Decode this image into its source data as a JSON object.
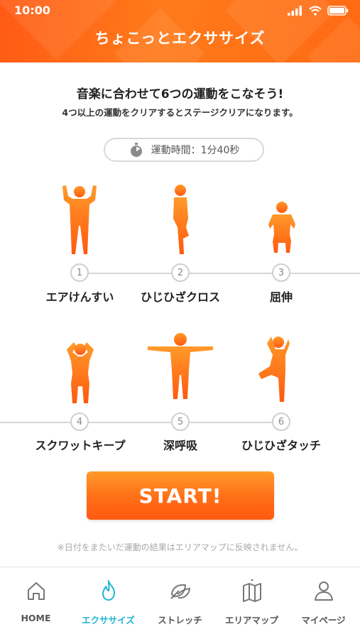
{
  "status_bar": {
    "time": "10:00"
  },
  "header": {
    "title": "ちょこっとエクササイズ"
  },
  "intro": {
    "title": "音楽に合わせて6つの運動をこなそう!",
    "subtitle": "4つ以上の運動をクリアするとステージクリアになります。"
  },
  "duration": {
    "text": "運動時間：1分40秒"
  },
  "exercises": [
    {
      "step": "1",
      "name": "エアけんすい"
    },
    {
      "step": "2",
      "name": "ひじひざクロス"
    },
    {
      "step": "3",
      "name": "屈伸"
    },
    {
      "step": "4",
      "name": "スクワットキープ"
    },
    {
      "step": "5",
      "name": "深呼吸"
    },
    {
      "step": "6",
      "name": "ひじひざタッチ"
    }
  ],
  "start_button": {
    "label": "START!"
  },
  "notice": "※日付をまたいだ運動の結果はエリアマップに反映されません。",
  "tabs": [
    {
      "label": "HOME",
      "icon": "home-icon"
    },
    {
      "label": "エクササイズ",
      "icon": "flame-icon",
      "active": true
    },
    {
      "label": "ストレッチ",
      "icon": "leaf-icon"
    },
    {
      "label": "エリアマップ",
      "icon": "map-icon"
    },
    {
      "label": "マイページ",
      "icon": "person-icon"
    }
  ],
  "colors": {
    "brand_orange": "#ff6a14",
    "active_tab": "#21b5d3",
    "muted_text": "#a8a8a8"
  }
}
